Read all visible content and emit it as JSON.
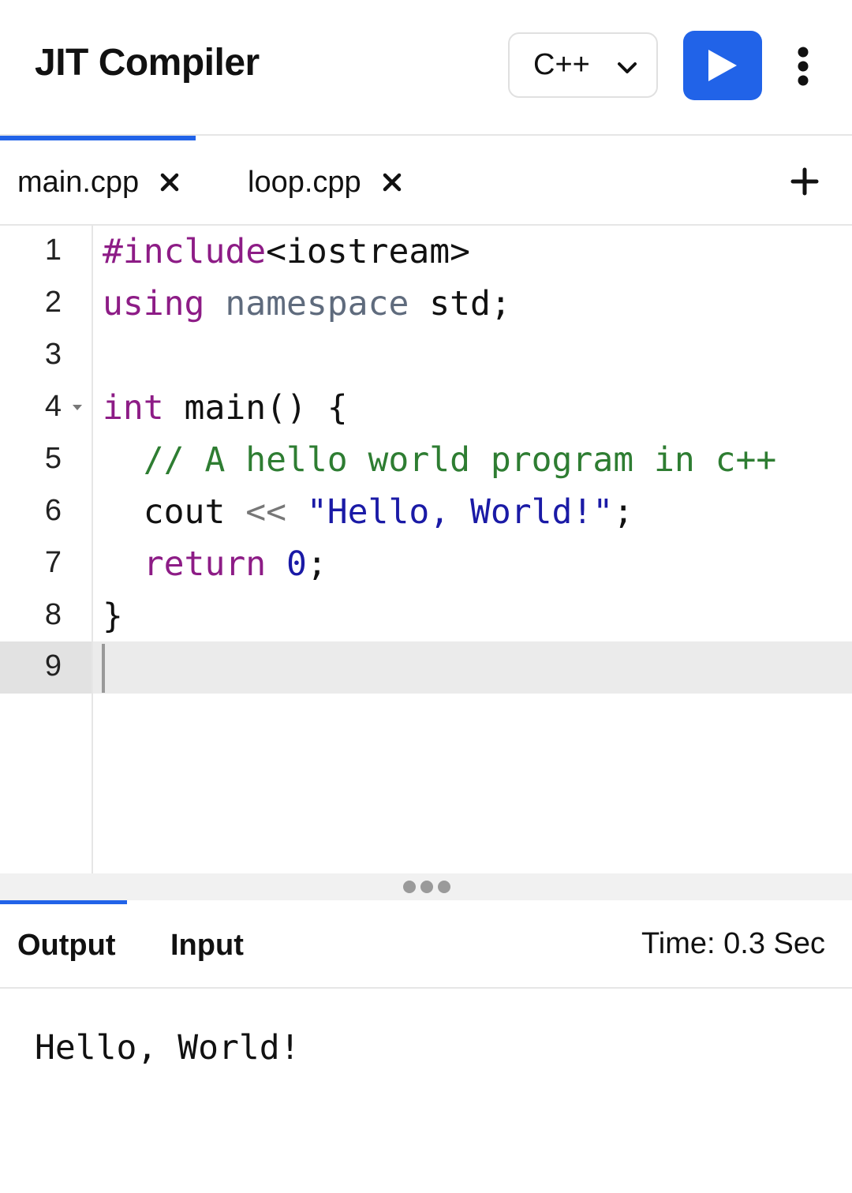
{
  "header": {
    "title": "JIT Compiler",
    "language": "C++",
    "run_icon": "play-icon",
    "more_icon": "more-vertical-icon",
    "accent_color": "#2163e8"
  },
  "file_tabs": [
    {
      "label": "main.cpp",
      "active": true
    },
    {
      "label": "loop.cpp",
      "active": false
    }
  ],
  "editor": {
    "line_numbers": [
      "1",
      "2",
      "3",
      "4",
      "5",
      "6",
      "7",
      "8",
      "9"
    ],
    "active_line": "9",
    "lines": [
      [
        {
          "t": "#include",
          "c": "kw"
        },
        {
          "t": "<iostream>",
          "c": ""
        }
      ],
      [
        {
          "t": "using",
          "c": "kw"
        },
        {
          "t": " ",
          "c": ""
        },
        {
          "t": "namespace",
          "c": "ns"
        },
        {
          "t": " std;",
          "c": ""
        }
      ],
      [],
      [
        {
          "t": "int",
          "c": "kw"
        },
        {
          "t": " main() {",
          "c": ""
        }
      ],
      [
        {
          "t": "  // A hello world program in c++",
          "c": "cm"
        }
      ],
      [
        {
          "t": "  cout ",
          "c": ""
        },
        {
          "t": "<<",
          "c": "op"
        },
        {
          "t": " ",
          "c": ""
        },
        {
          "t": "\"Hello, World!\"",
          "c": "str"
        },
        {
          "t": ";",
          "c": ""
        }
      ],
      [
        {
          "t": "  ",
          "c": ""
        },
        {
          "t": "return",
          "c": "kw"
        },
        {
          "t": " ",
          "c": ""
        },
        {
          "t": "0",
          "c": "num"
        },
        {
          "t": ";",
          "c": ""
        }
      ],
      [
        {
          "t": "}",
          "c": ""
        }
      ],
      []
    ]
  },
  "output_panel": {
    "tabs": [
      "Output",
      "Input"
    ],
    "active_tab": "Output",
    "time": "Time: 0.3 Sec",
    "output_text": "Hello, World!"
  }
}
